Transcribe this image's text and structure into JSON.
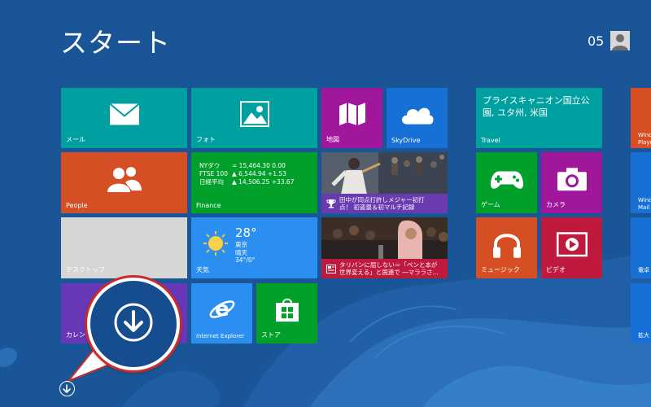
{
  "screen": {
    "title": "スタート"
  },
  "user": {
    "name": "05"
  },
  "tiles": {
    "mail": {
      "label": "メール",
      "color": "#00a0a0",
      "icon": "mail-icon"
    },
    "photos": {
      "label": "フォト",
      "color": "#00a0a0",
      "icon": "photos-icon"
    },
    "maps": {
      "label": "地図",
      "color": "#a0179c",
      "icon": "maps-icon"
    },
    "skydrive": {
      "label": "SkyDrive",
      "color": "#1670d6",
      "icon": "cloud-icon"
    },
    "people": {
      "label": "People",
      "color": "#d64e24",
      "icon": "people-icon"
    },
    "finance": {
      "label": "Finance",
      "color": "#00a02a",
      "rows": [
        {
          "name": "NYダウ",
          "value": "= 15,464.30 0.00"
        },
        {
          "name": "FTSE 100",
          "value": "▲ 6,544.94 +1.53"
        },
        {
          "name": "日経平均",
          "value": "▲ 14,506.25 +33.67"
        }
      ]
    },
    "sports": {
      "caption_line1": "田中が同点打許しメジャー初打",
      "caption_line2": "点！ 初盗塁＆初マルチ記録",
      "color": "#6a3ab0",
      "icon": "trophy-icon"
    },
    "desktop": {
      "label": "デスクトップ",
      "color": "#d6d6d6"
    },
    "weather": {
      "label": "天気",
      "color": "#2a8ff0",
      "temp": "28°",
      "city": "東京",
      "condition": "晴天",
      "range": "34°/0°",
      "icon": "sun-icon"
    },
    "news": {
      "caption_line1": "タリバンに屈しない＝「ペンと本が",
      "caption_line2": "世界変える」と国連で ―マララさ...",
      "color": "#c0193e",
      "icon": "news-icon"
    },
    "calendar": {
      "label": "カレンダー",
      "color": "#6638b8"
    },
    "ie": {
      "label": "Internet Explorer",
      "color": "#2a8ff0",
      "icon": "internet-explorer-icon"
    },
    "store": {
      "label": "ストア",
      "color": "#00a02a",
      "icon": "store-icon"
    },
    "travel": {
      "label": "Travel",
      "color": "#00a0a0",
      "headline": "プライスキャニオン国立公園, ユタ州, 米国"
    },
    "games": {
      "label": "ゲーム",
      "color": "#00a02a",
      "icon": "game-controller-icon"
    },
    "camera": {
      "label": "カメラ",
      "color": "#a0179c",
      "icon": "camera-icon"
    },
    "music": {
      "label": "ミュージック",
      "color": "#d64e24",
      "icon": "headphones-icon"
    },
    "video": {
      "label": "ビデオ",
      "color": "#c0193e",
      "icon": "video-icon"
    }
  },
  "edge_tiles": [
    {
      "label": "Wind",
      "label2": "Playe",
      "color": "#d64e24"
    },
    {
      "label": "Wind",
      "label2": "Mail",
      "color": "#1670d6"
    },
    {
      "label": "電卓",
      "label2": "",
      "color": "#1670d6"
    },
    {
      "label": "拡大",
      "label2": "",
      "color": "#1670d6"
    }
  ],
  "callout": {
    "icon": "down-arrow-icon",
    "accent": "#c92b2b"
  },
  "all_apps": {
    "icon": "down-arrow-icon"
  }
}
